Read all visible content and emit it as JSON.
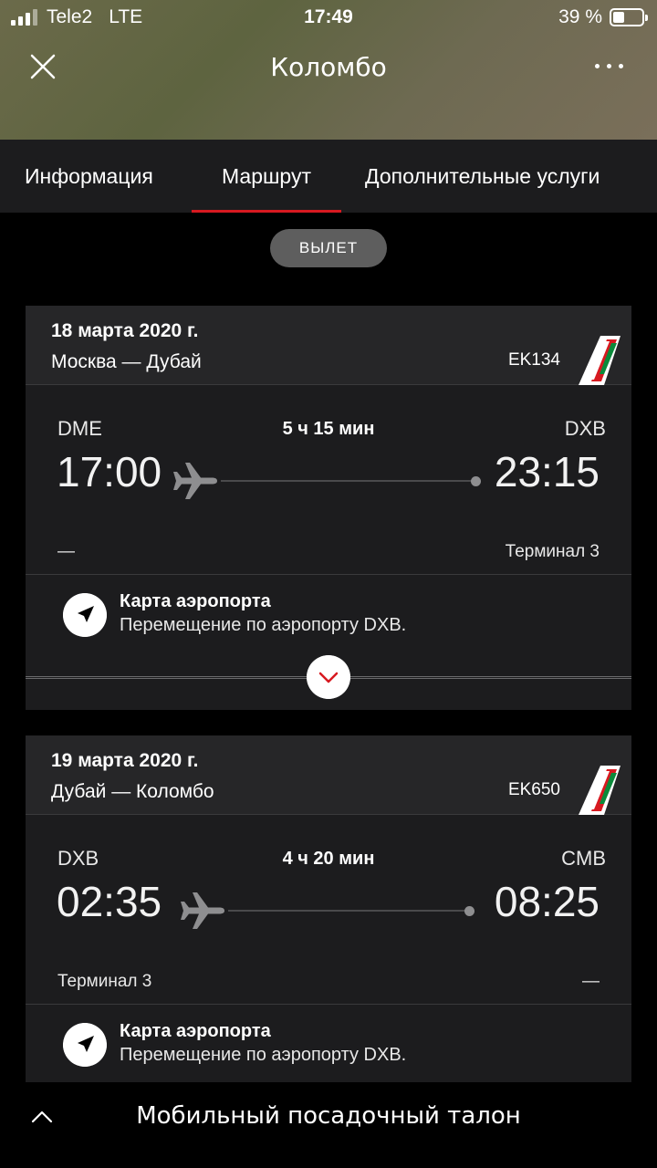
{
  "status_bar": {
    "carrier": "Tele2",
    "network": "LTE",
    "time": "17:49",
    "battery_text": "39 %",
    "battery_level": 0.39
  },
  "header": {
    "title": "Коломбо",
    "close_icon": "close-icon",
    "more_icon": "more-dots-icon"
  },
  "tabs": [
    {
      "label": "Информация"
    },
    {
      "label": "Маршрут",
      "active": true
    },
    {
      "label": "Дополнительные услуги"
    }
  ],
  "segment_pill": "ВЫЛЕТ",
  "colors": {
    "accent": "#d71920",
    "card_bg": "#1c1c1e",
    "card_head_bg": "#262628"
  },
  "flights": [
    {
      "date": "18 марта 2020 г.",
      "route": "Москва — Дубай",
      "flight_number": "EK134",
      "from_code": "DME",
      "to_code": "DXB",
      "duration": "5 ч 15 мин",
      "dep_time": "17:00",
      "arr_time": "23:15",
      "dep_terminal": "—",
      "arr_terminal": "Терминал 3",
      "map_title": "Карта аэропорта",
      "map_subtitle": "Перемещение по аэропорту DXB."
    },
    {
      "date": "19 марта 2020 г.",
      "route": "Дубай — Коломбо",
      "flight_number": "EK650",
      "from_code": "DXB",
      "to_code": "CMB",
      "duration": "4 ч 20 мин",
      "dep_time": "02:35",
      "arr_time": "08:25",
      "dep_terminal": "Терминал 3",
      "arr_terminal": "—",
      "map_title": "Карта аэропорта",
      "map_subtitle": "Перемещение по аэропорту DXB."
    }
  ],
  "bottom_bar": {
    "label": "Мобильный посадочный талон",
    "icon": "chevron-up-icon"
  }
}
